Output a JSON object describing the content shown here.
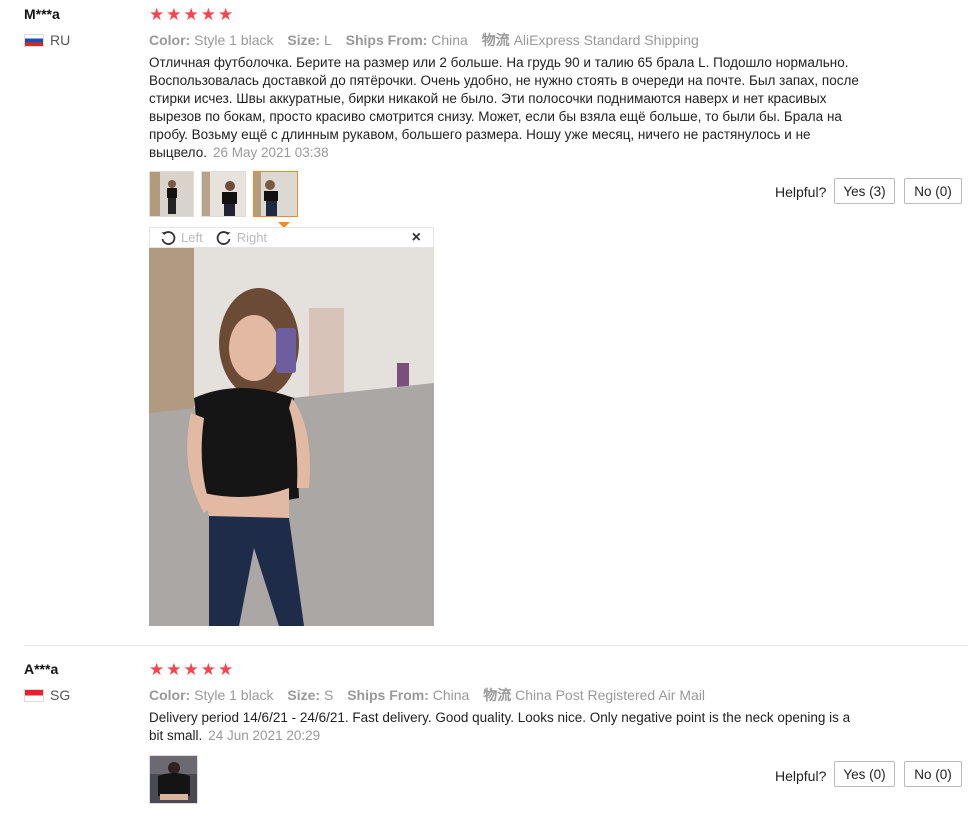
{
  "colors": {
    "star": "#f5464f",
    "accent": "#f08a24",
    "muted": "#999999"
  },
  "labels": {
    "color": "Color:",
    "size": "Size:",
    "ships_from": "Ships From:",
    "logistics": "物流",
    "helpful": "Helpful?"
  },
  "reviews": [
    {
      "user": "M***a",
      "country": "RU",
      "flag": "russia-flag",
      "rating": 5,
      "color_value": "Style 1 black",
      "size_value": "L",
      "ships_from_value": "China",
      "shipping_value": "AliExpress Standard Shipping",
      "text": "Отличная футболочка. Берите на размер или 2 больше. На грудь 90 и талию 65 брала L. Подошло нормально. Воспользовалась доставкой до пятёрочки. Очень удобно, не нужно стоять в очереди на почте. Был запах, после стирки исчез. Швы аккуратные, бирки никакой не было. Эти полосочки поднимаются наверх и нет красивых вырезов по бокам, просто красиво смотрится снизу. Может, если бы взяла ещё больше, то были бы. Брала на пробу. Возьму ещё с длинным рукавом, большего размера. Ношу уже месяц, ничего не растянулось и не выцвело.",
      "date": "26 May 2021 03:38",
      "yes_label": "Yes (3)",
      "no_label": "No (0)",
      "viewer": {
        "left_label": "Left",
        "right_label": "Right",
        "close": "×"
      }
    },
    {
      "user": "A***a",
      "country": "SG",
      "flag": "singapore-flag",
      "rating": 5,
      "color_value": "Style 1 black",
      "size_value": "S",
      "ships_from_value": "China",
      "shipping_value": "China Post Registered Air Mail",
      "text": "Delivery period 14/6/21 - 24/6/21. Fast delivery. Good quality. Looks nice. Only negative point is the neck opening is a bit small.",
      "date": "24 Jun 2021 20:29",
      "yes_label": "Yes (0)",
      "no_label": "No (0)"
    }
  ]
}
